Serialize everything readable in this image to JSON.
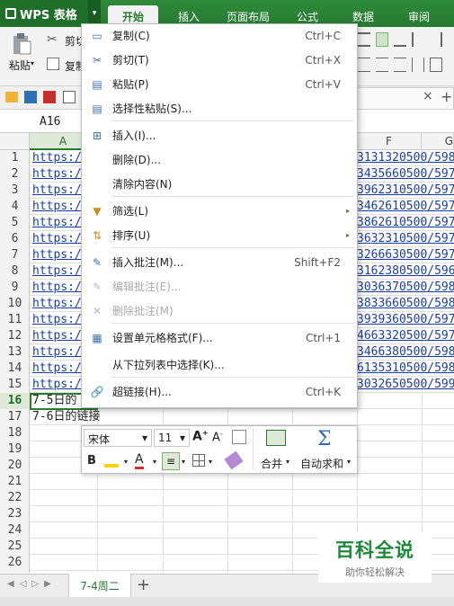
{
  "app": {
    "title": "WPS 表格"
  },
  "tabs": [
    "开始",
    "插入",
    "页面布局",
    "公式",
    "数据",
    "审阅"
  ],
  "ribbon": {
    "paste_label": "粘贴",
    "cut_label": "剪切",
    "copy_label": "复制"
  },
  "name_box": "A16",
  "columns": [
    "A",
    "F",
    "G"
  ],
  "rows": [
    "1",
    "2",
    "3",
    "4",
    "5",
    "6",
    "7",
    "8",
    "9",
    "10",
    "11",
    "12",
    "13",
    "14",
    "15",
    "16",
    "17",
    "18",
    "19",
    "20",
    "21",
    "22",
    "23",
    "24",
    "25",
    "26"
  ],
  "col_a": [
    "https:/",
    "https:/",
    "https:/",
    "https:/",
    "https:/",
    "https:/",
    "https:/",
    "https:/",
    "https:/",
    "https:/",
    "https:/",
    "https:/",
    "https:/",
    "https:/",
    "https:/",
    "7-5日的",
    "7-6日的链接"
  ],
  "col_f": [
    "3131320500/598",
    "3435660500/597",
    "3962310500/597",
    "3462610500/597",
    "3862610500/597",
    "3632310500/597",
    "3266630500/597",
    "3162380500/596",
    "3036370500/598",
    "3833660500/598",
    "3939360500/597",
    "4663320500/597",
    "3466380500/598",
    "6135310500/598",
    "3032650500/599"
  ],
  "menu": [
    {
      "label": "复制(C)",
      "shortcut": "Ctrl+C",
      "icon": "copy-icon",
      "disabled": false
    },
    {
      "label": "剪切(T)",
      "shortcut": "Ctrl+X",
      "icon": "scissors-icon",
      "disabled": false
    },
    {
      "label": "粘贴(P)",
      "shortcut": "Ctrl+V",
      "icon": "paste-icon",
      "disabled": false
    },
    {
      "label": "选择性粘贴(S)...",
      "shortcut": "",
      "icon": "paste-special-icon",
      "disabled": false
    },
    {
      "label": "插入(I)...",
      "shortcut": "",
      "icon": "insert-cells-icon",
      "disabled": false
    },
    {
      "label": "删除(D)...",
      "shortcut": "",
      "icon": "",
      "disabled": false
    },
    {
      "label": "清除内容(N)",
      "shortcut": "",
      "icon": "",
      "disabled": false
    },
    {
      "label": "筛选(L)",
      "shortcut": "",
      "icon": "filter-icon",
      "disabled": false,
      "submenu": true
    },
    {
      "label": "排序(U)",
      "shortcut": "",
      "icon": "sort-icon",
      "disabled": false,
      "submenu": true
    },
    {
      "label": "插入批注(M)...",
      "shortcut": "Shift+F2",
      "icon": "insert-comment-icon",
      "disabled": false
    },
    {
      "label": "编辑批注(E)...",
      "shortcut": "",
      "icon": "edit-comment-icon",
      "disabled": true
    },
    {
      "label": "删除批注(M)",
      "shortcut": "",
      "icon": "delete-comment-icon",
      "disabled": true
    },
    {
      "label": "设置单元格格式(F)...",
      "shortcut": "Ctrl+1",
      "icon": "format-cells-icon",
      "disabled": false
    },
    {
      "label": "从下拉列表中选择(K)...",
      "shortcut": "",
      "icon": "",
      "disabled": false
    },
    {
      "label": "超链接(H)...",
      "shortcut": "Ctrl+K",
      "icon": "hyperlink-icon",
      "disabled": false
    }
  ],
  "mini_toolbar": {
    "font": "宋体",
    "size": "11",
    "merge_label": "合并",
    "autosum_label": "自动求和"
  },
  "sheet_tab": "7-4周二",
  "watermark": {
    "title": "百科全说",
    "subtitle": "助你轻松解决"
  },
  "colors": {
    "brand": "#267a31",
    "link": "#1a3ea8"
  }
}
